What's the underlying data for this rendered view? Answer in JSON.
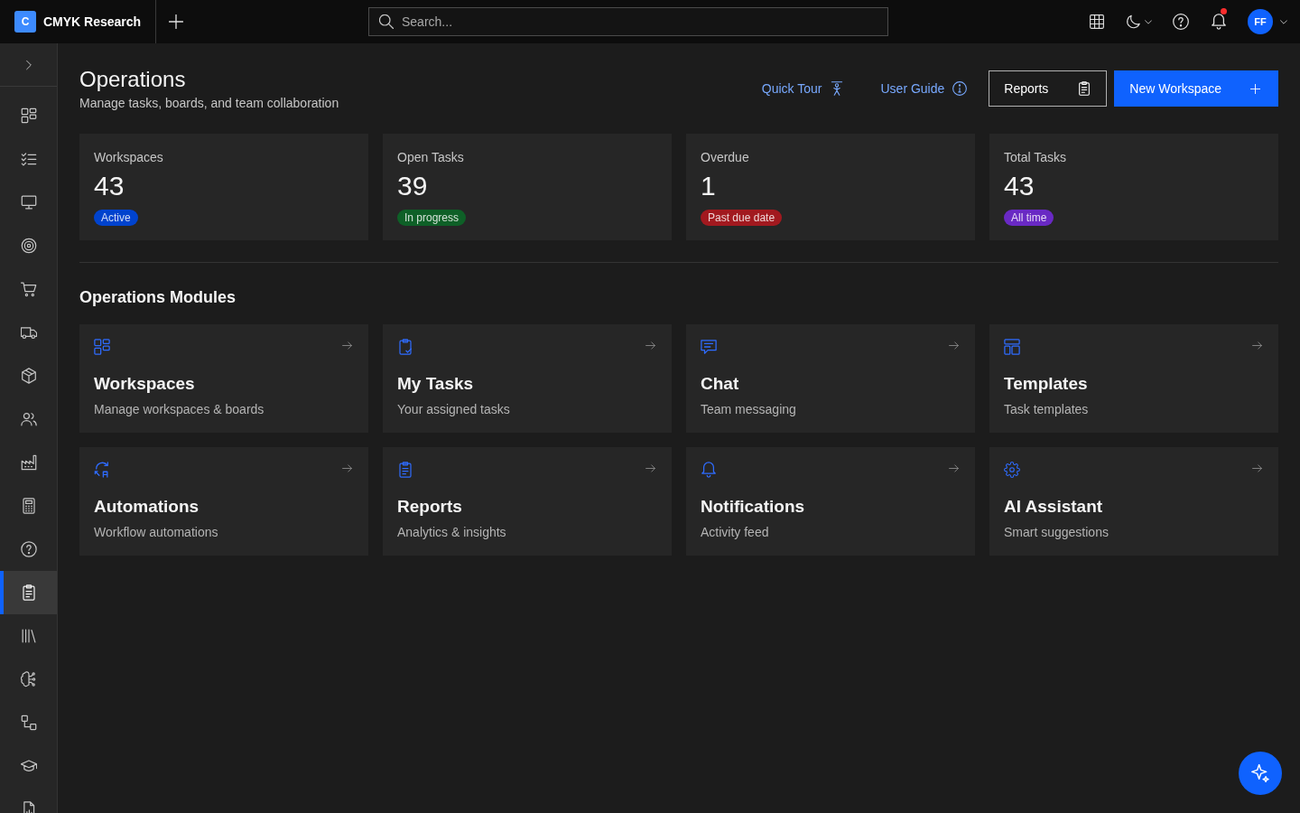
{
  "top_bar": {
    "brand": {
      "logo": "C",
      "name": "CMYK Research"
    },
    "search": {
      "placeholder": "Search..."
    },
    "notifications": {
      "unread": true
    },
    "account": {
      "initials": "FF"
    }
  },
  "sidebar": {
    "items": [
      {
        "selected": false
      },
      {
        "selected": false
      },
      {
        "selected": false
      },
      {
        "selected": false
      },
      {
        "selected": false
      },
      {
        "selected": false
      },
      {
        "selected": false
      },
      {
        "selected": false
      },
      {
        "selected": false
      },
      {
        "selected": false
      },
      {
        "selected": false
      },
      {
        "selected": true
      },
      {
        "selected": false
      },
      {
        "selected": false
      },
      {
        "selected": false
      },
      {
        "selected": false
      },
      {
        "selected": false
      }
    ]
  },
  "header": {
    "title": "Operations",
    "subtitle": "Manage tasks, boards, and team collaboration",
    "links": [
      {
        "label": "Quick Tour"
      },
      {
        "label": "User Guide"
      }
    ],
    "buttons": [
      {
        "label": "Reports",
        "kind": "secondary"
      },
      {
        "label": "New Workspace",
        "kind": "primary"
      }
    ]
  },
  "stats": [
    {
      "label": "Workspaces",
      "value": "43",
      "badge": "Active",
      "color": "#0043ce"
    },
    {
      "label": "Open Tasks",
      "value": "39",
      "badge": "In progress",
      "color": "#0e6027"
    },
    {
      "label": "Overdue",
      "value": "1",
      "badge": "Past due date",
      "color": "#a2191f"
    },
    {
      "label": "Total Tasks",
      "value": "43",
      "badge": "All time",
      "color": "#6929c4"
    }
  ],
  "modules_section": {
    "title": "Operations Modules",
    "modules": [
      {
        "title": "Workspaces",
        "description": "Manage workspaces & boards"
      },
      {
        "title": "My Tasks",
        "description": "Your assigned tasks"
      },
      {
        "title": "Chat",
        "description": "Team messaging"
      },
      {
        "title": "Templates",
        "description": "Task templates"
      },
      {
        "title": "Automations",
        "description": "Workflow automations"
      },
      {
        "title": "Reports",
        "description": "Analytics & insights"
      },
      {
        "title": "Notifications",
        "description": "Activity feed"
      },
      {
        "title": "AI Assistant",
        "description": "Smart suggestions"
      }
    ]
  }
}
